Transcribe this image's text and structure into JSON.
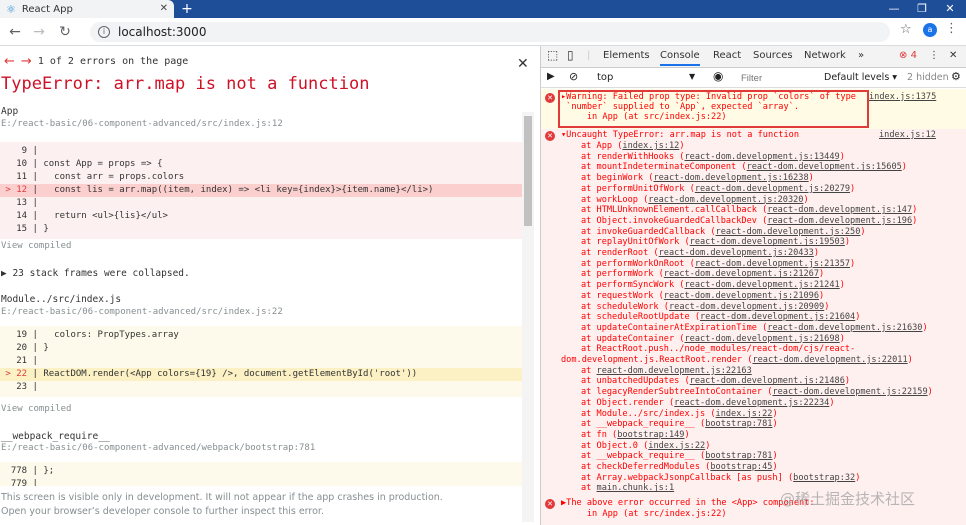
{
  "browser": {
    "tab_title": "React App",
    "url": "localhost:3000"
  },
  "overlay": {
    "error_counter": "1 of 2 errors on the page",
    "error_title": "TypeError: arr.map is not a function",
    "frame1": {
      "name": "App",
      "path": "E:/react-basic/06-component-advanced/src/index.js:12"
    },
    "code1": [
      {
        "ln": "  9",
        "text": " |"
      },
      {
        "ln": " 10",
        "text": " | const App = props => {"
      },
      {
        "ln": " 11",
        "text": " |   const arr = props.colors"
      },
      {
        "ln": "> 12",
        "text": " |   const lis = arr.map((item, index) => <li key={index}>{item.name}</li>)"
      },
      {
        "ln": " 13",
        "text": " |"
      },
      {
        "ln": " 14",
        "text": " |   return <ul>{lis}</ul>"
      },
      {
        "ln": " 15",
        "text": " | }"
      }
    ],
    "view_compiled": "View compiled",
    "collapsed": "▶ 23 stack frames were collapsed.",
    "frame2": {
      "name": "Module../src/index.js",
      "path": "E:/react-basic/06-component-advanced/src/index.js:22"
    },
    "code2": [
      {
        "ln": " 19",
        "text": " |   colors: PropTypes.array"
      },
      {
        "ln": " 20",
        "text": " | }"
      },
      {
        "ln": " 21",
        "text": " |"
      },
      {
        "ln": "> 22",
        "text": " | ReactDOM.render(<App colors={19} />, document.getElementById('root'))"
      },
      {
        "ln": " 23",
        "text": " |"
      }
    ],
    "frame3": {
      "name": "__webpack_require__",
      "path": "E:/react-basic/06-component-advanced/webpack/bootstrap:781"
    },
    "code3": [
      {
        "ln": " 778",
        "text": " | };"
      },
      {
        "ln": " 779",
        "text": " |"
      }
    ],
    "footer1": "This screen is visible only in development. It will not appear if the app crashes in production.",
    "footer2": "Open your browser’s developer console to further inspect this error."
  },
  "devtools": {
    "tabs": [
      "Elements",
      "Console",
      "React",
      "Sources",
      "Network"
    ],
    "more": "»",
    "error_count": "4",
    "context": "top",
    "filter_placeholder": "Filter",
    "levels": "Default levels ▾",
    "hidden": "2 hidden",
    "warning": {
      "lines": [
        "▸Warning: Failed prop type: Invalid prop `colors` of type",
        " `number` supplied to `App`, expected `array`.",
        "     in App (at src/index.js:22)"
      ],
      "ref": "index.js:1375"
    },
    "error1_head": "▾Uncaught TypeError: arr.map is not a function",
    "error1_ref": "index.js:12",
    "stack": [
      [
        "at App (",
        "index.js:12",
        ")"
      ],
      [
        "at renderWithHooks (",
        "react-dom.development.js:13449",
        ")"
      ],
      [
        "at mountIndeterminateComponent (",
        "react-dom.development.js:15605",
        ")"
      ],
      [
        "at beginWork (",
        "react-dom.development.js:16238",
        ")"
      ],
      [
        "at performUnitOfWork (",
        "react-dom.development.js:20279",
        ")"
      ],
      [
        "at workLoop (",
        "react-dom.development.js:20320",
        ")"
      ],
      [
        "at HTMLUnknownElement.callCallback (",
        "react-dom.development.js:147",
        ")"
      ],
      [
        "at Object.invokeGuardedCallbackDev (",
        "react-dom.development.js:196",
        ")"
      ],
      [
        "at invokeGuardedCallback (",
        "react-dom.development.js:250",
        ")"
      ],
      [
        "at replayUnitOfWork (",
        "react-dom.development.js:19503",
        ")"
      ],
      [
        "at renderRoot (",
        "react-dom.development.js:20433",
        ")"
      ],
      [
        "at performWorkOnRoot (",
        "react-dom.development.js:21357",
        ")"
      ],
      [
        "at performWork (",
        "react-dom.development.js:21267",
        ")"
      ],
      [
        "at performSyncWork (",
        "react-dom.development.js:21241",
        ")"
      ],
      [
        "at requestWork (",
        "react-dom.development.js:21096",
        ")"
      ],
      [
        "at scheduleWork (",
        "react-dom.development.js:20909",
        ")"
      ],
      [
        "at scheduleRootUpdate (",
        "react-dom.development.js:21604",
        ")"
      ],
      [
        "at updateContainerAtExpirationTime (",
        "react-dom.development.js:21630",
        ")"
      ],
      [
        "at updateContainer (",
        "react-dom.development.js:21698",
        ")"
      ],
      [
        "at ReactRoot.push../node_modules/react-dom/cjs/react-",
        "",
        ""
      ],
      [
        "dom.development.js.ReactRoot.render (",
        "react-dom.development.js:22011",
        ")"
      ],
      [
        "at ",
        "react-dom.development.js:22163",
        ""
      ],
      [
        "at unbatchedUpdates (",
        "react-dom.development.js:21486",
        ")"
      ],
      [
        "at legacyRenderSubtreeIntoContainer (",
        "react-dom.development.js:22159",
        ")"
      ],
      [
        "at Object.render (",
        "react-dom.development.js:22234",
        ")"
      ],
      [
        "at Module../src/index.js (",
        "index.js:22",
        ")"
      ],
      [
        "at __webpack_require__ (",
        "bootstrap:781",
        ")"
      ],
      [
        "at fn (",
        "bootstrap:149",
        ")"
      ],
      [
        "at Object.0 (",
        "index.js:22",
        ")"
      ],
      [
        "at __webpack_require__ (",
        "bootstrap:781",
        ")"
      ],
      [
        "at checkDeferredModules (",
        "bootstrap:45",
        ")"
      ],
      [
        "at Array.webpackJsonpCallback [as push] (",
        "bootstrap:32",
        ")"
      ],
      [
        "at ",
        "main.chunk.js:1",
        ""
      ]
    ],
    "error2_head": "▶The above error occurred in the <App> component:",
    "error2_sub": "     in App (at src/index.js:22)"
  },
  "watermark": "@稀土掘金技术社区",
  "colors": {
    "error": "#e03a3a",
    "title_bar": "#1f4e98",
    "accent": "#1a73e8"
  }
}
